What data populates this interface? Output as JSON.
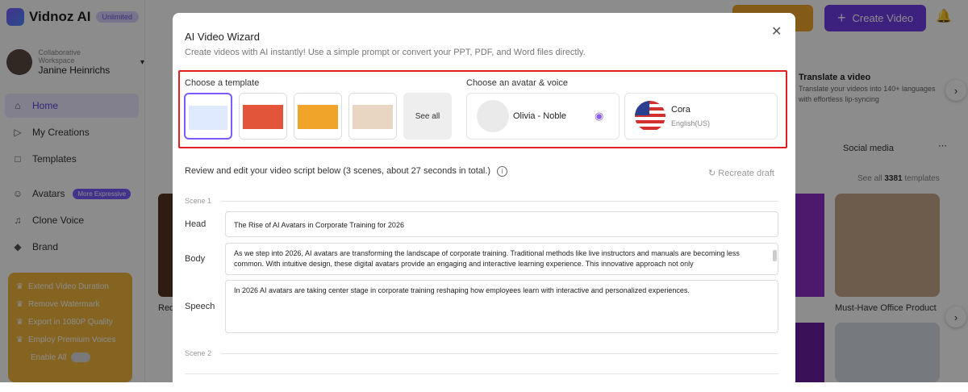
{
  "app": {
    "name": "Vidnoz AI",
    "badge": "Unlimited"
  },
  "workspace": {
    "label": "Collaborative Workspace",
    "user": "Janine Heinrichs"
  },
  "sidebar": {
    "items": [
      {
        "label": "Home",
        "icon": "home-icon"
      },
      {
        "label": "My Creations",
        "icon": "play-icon"
      },
      {
        "label": "Templates",
        "icon": "template-icon"
      },
      {
        "label": "Avatars",
        "icon": "avatar-icon",
        "pill": "More Expressive"
      },
      {
        "label": "Clone Voice",
        "icon": "voice-icon"
      },
      {
        "label": "Brand",
        "icon": "brand-icon"
      }
    ],
    "promo": [
      "Extend Video Duration",
      "Remove Watermark",
      "Export in 1080P Quality",
      "Employ Premium Voices",
      "Enable All"
    ]
  },
  "header": {
    "create_video": "Create Video"
  },
  "background": {
    "translate_title": "Translate a video",
    "translate_desc": "Translate your videos into 140+ languages with effortless lip-syncing",
    "tab_social": "Social media",
    "see_all": "See all",
    "template_count": "3381",
    "templates_word": "templates",
    "card_label": "Must-Have Office Product",
    "card_left_label": "Red"
  },
  "modal": {
    "title": "AI Video Wizard",
    "subtitle": "Create videos with AI instantly! Use a simple prompt or convert your PPT, PDF, and Word files directly.",
    "choose_template": "Choose a template",
    "see_all": "See all",
    "choose_avatar": "Choose an avatar & voice",
    "avatar_name": "Olivia - Noble",
    "voice_name": "Cora",
    "voice_lang": "English(US)",
    "review_text": "Review and edit your video script below (3 scenes, about 27 seconds in total.)",
    "recreate": "Recreate draft",
    "scene1": "Scene 1",
    "scene2": "Scene 2",
    "head_label": "Head",
    "head_value": "The Rise of AI Avatars in Corporate Training for 2026",
    "body_label": "Body",
    "body_value": "As we step into 2026, AI avatars are transforming the landscape of corporate training. Traditional methods like live instructors and manuals are becoming less common. With intuitive design, these digital avatars provide an engaging and interactive learning experience. This innovative approach not only",
    "speech_label": "Speech",
    "speech_value": "In 2026 AI avatars are taking center stage in corporate training reshaping how employees learn with interactive and personalized experiences."
  },
  "colors": {
    "accent": "#6d3ce7",
    "highlight": "#e02020"
  }
}
